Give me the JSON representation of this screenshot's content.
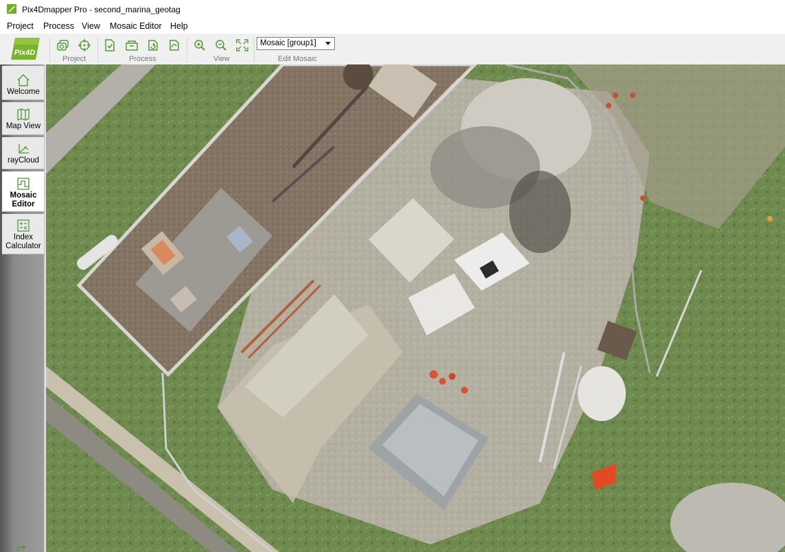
{
  "window": {
    "title": "Pix4Dmapper Pro - second_marina_geotag"
  },
  "menu": [
    "Project",
    "Process",
    "View",
    "Mosaic Editor",
    "Help"
  ],
  "toolbar": {
    "logo_text": "Pix4D",
    "groups": {
      "project": "Project",
      "process": "Process",
      "view": "View",
      "edit_mosaic": "Edit Mosaic"
    },
    "mosaic_select": {
      "value": "Mosaic [group1]"
    },
    "icons": [
      "images-icon",
      "gcp-target-icon",
      "processing-check-icon",
      "open-folder-icon",
      "reoptimize-icon",
      "rematch-icon",
      "zoom-in-icon",
      "zoom-out-icon",
      "zoom-fit-icon"
    ]
  },
  "sidebar": {
    "items": [
      {
        "label": "Welcome",
        "icon": "home-icon",
        "active": false
      },
      {
        "label": "Map View",
        "icon": "map-icon",
        "active": false
      },
      {
        "label": "rayCloud",
        "icon": "raycloud-icon",
        "active": false
      },
      {
        "label": "Mosaic Editor",
        "icon": "mosaic-editor-icon",
        "active": true
      },
      {
        "label": "Index Calculator",
        "icon": "index-calculator-icon",
        "active": false
      }
    ]
  },
  "colors": {
    "accent_green": "#5a9e2a",
    "logo_green": "#7ab32a",
    "icon_green": "#4f9a32"
  }
}
